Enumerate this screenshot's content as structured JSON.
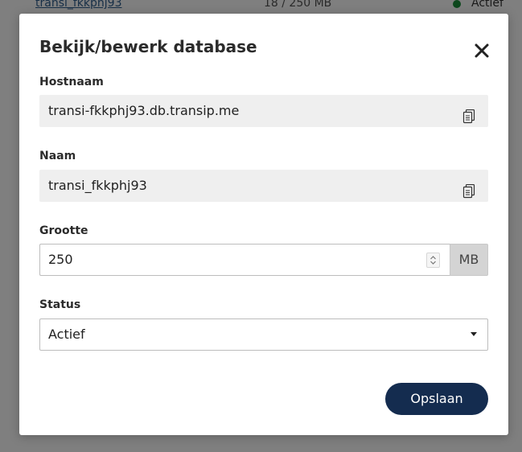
{
  "background": {
    "row": {
      "name": "transi_fkkphj93",
      "size": "18 / 250 MB",
      "status": "Actief",
      "status_color": "#1a8f3a"
    }
  },
  "modal": {
    "title": "Bekijk/bewerk database",
    "close_icon": "close-icon",
    "fields": {
      "hostname": {
        "label": "Hostnaam",
        "value": "transi-fkkphj93.db.transip.me",
        "icon": "copy-icon"
      },
      "name": {
        "label": "Naam",
        "value": "transi_fkkphj93",
        "icon": "copy-icon"
      },
      "size": {
        "label": "Grootte",
        "value": "250",
        "unit": "MB"
      },
      "status": {
        "label": "Status",
        "selected": "Actief"
      }
    },
    "save_label": "Opslaan",
    "colors": {
      "primary_button": "#142c4f",
      "readonly_bg": "#efefef",
      "addon_bg": "#d4d4d4"
    }
  }
}
